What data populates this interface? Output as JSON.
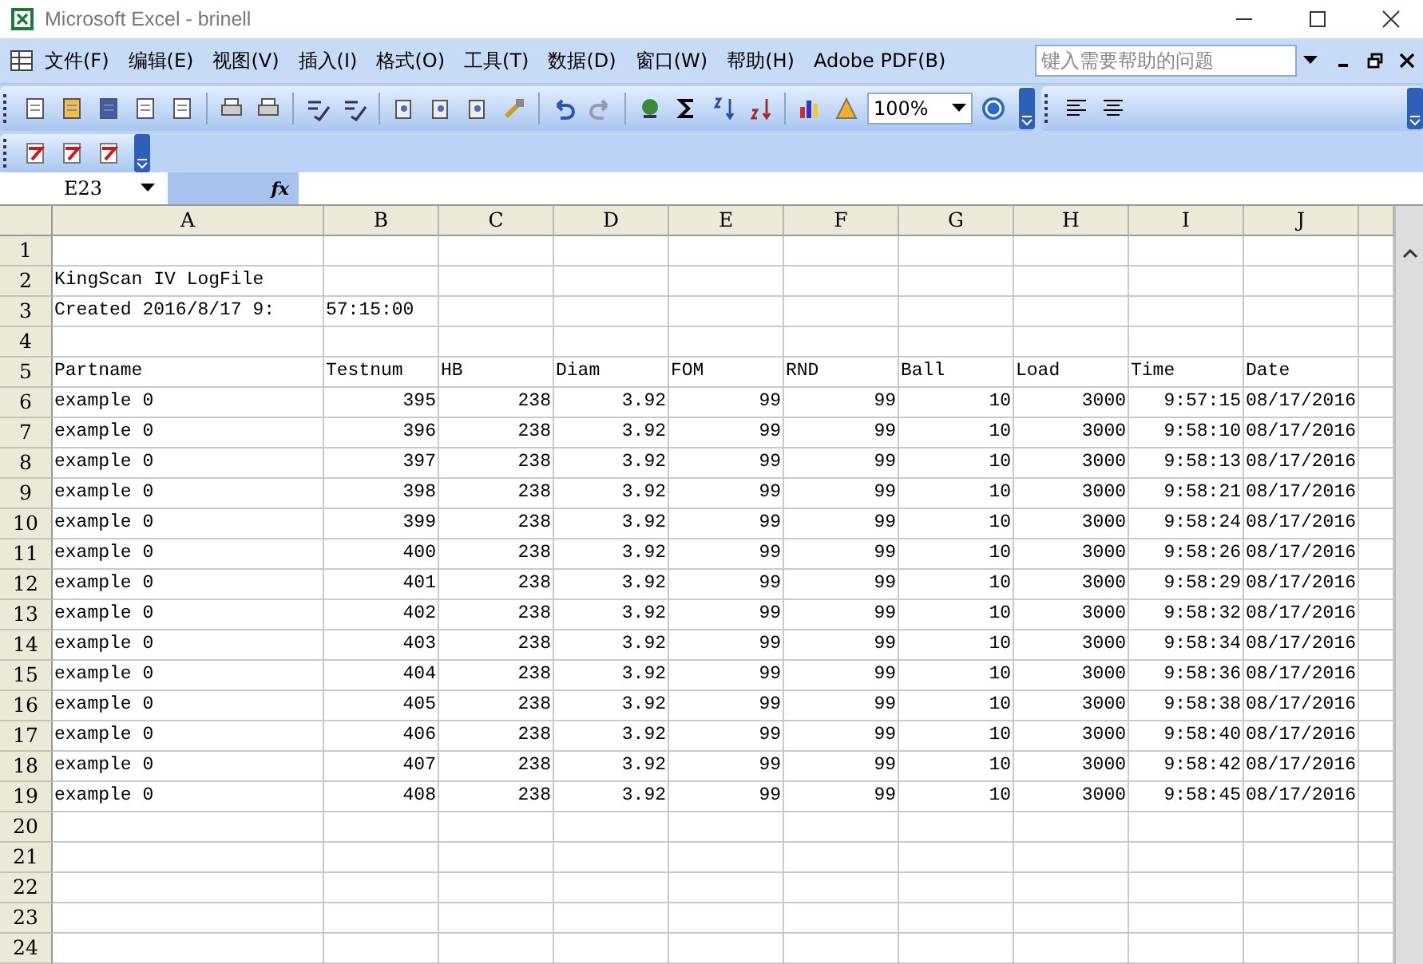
{
  "window": {
    "title": "Microsoft Excel - brinell"
  },
  "menu": [
    "文件(F)",
    "编辑(E)",
    "视图(V)",
    "插入(I)",
    "格式(O)",
    "工具(T)",
    "数据(D)",
    "窗口(W)",
    "帮助(H)",
    "Adobe PDF(B)"
  ],
  "help_box": {
    "placeholder": "键入需要帮助的问题"
  },
  "zoom": {
    "value": "100%"
  },
  "formula_bar": {
    "name_box": "E23",
    "fx_label": "fx"
  },
  "sheet": {
    "columns": [
      "A",
      "B",
      "C",
      "D",
      "E",
      "F",
      "G",
      "H",
      "I",
      "J"
    ],
    "rows": [
      {
        "number": "1",
        "kind": "label"
      },
      {
        "number": "2",
        "kind": "label",
        "cells": [
          "KingScan IV LogFile"
        ]
      },
      {
        "number": "3",
        "kind": "label",
        "cells": [
          "Created 2016/8/17 9:",
          "57:15:00"
        ]
      },
      {
        "number": "4",
        "kind": "label"
      },
      {
        "number": "5",
        "kind": "label",
        "cells": [
          "Partname",
          "Testnum",
          "HB",
          "Diam",
          "FOM",
          "RND",
          "Ball",
          "Load",
          "Time",
          "Date"
        ]
      },
      {
        "number": "6",
        "kind": "data",
        "cells": [
          "example 0",
          "395",
          "238",
          "3.92",
          "99",
          "99",
          "10",
          "3000",
          "9:57:15",
          "08/17/2016"
        ]
      },
      {
        "number": "7",
        "kind": "data",
        "cells": [
          "example 0",
          "396",
          "238",
          "3.92",
          "99",
          "99",
          "10",
          "3000",
          "9:58:10",
          "08/17/2016"
        ]
      },
      {
        "number": "8",
        "kind": "data",
        "cells": [
          "example 0",
          "397",
          "238",
          "3.92",
          "99",
          "99",
          "10",
          "3000",
          "9:58:13",
          "08/17/2016"
        ]
      },
      {
        "number": "9",
        "kind": "data",
        "cells": [
          "example 0",
          "398",
          "238",
          "3.92",
          "99",
          "99",
          "10",
          "3000",
          "9:58:21",
          "08/17/2016"
        ]
      },
      {
        "number": "10",
        "kind": "data",
        "cells": [
          "example 0",
          "399",
          "238",
          "3.92",
          "99",
          "99",
          "10",
          "3000",
          "9:58:24",
          "08/17/2016"
        ]
      },
      {
        "number": "11",
        "kind": "data",
        "cells": [
          "example 0",
          "400",
          "238",
          "3.92",
          "99",
          "99",
          "10",
          "3000",
          "9:58:26",
          "08/17/2016"
        ]
      },
      {
        "number": "12",
        "kind": "data",
        "cells": [
          "example 0",
          "401",
          "238",
          "3.92",
          "99",
          "99",
          "10",
          "3000",
          "9:58:29",
          "08/17/2016"
        ]
      },
      {
        "number": "13",
        "kind": "data",
        "cells": [
          "example 0",
          "402",
          "238",
          "3.92",
          "99",
          "99",
          "10",
          "3000",
          "9:58:32",
          "08/17/2016"
        ]
      },
      {
        "number": "14",
        "kind": "data",
        "cells": [
          "example 0",
          "403",
          "238",
          "3.92",
          "99",
          "99",
          "10",
          "3000",
          "9:58:34",
          "08/17/2016"
        ]
      },
      {
        "number": "15",
        "kind": "data",
        "cells": [
          "example 0",
          "404",
          "238",
          "3.92",
          "99",
          "99",
          "10",
          "3000",
          "9:58:36",
          "08/17/2016"
        ]
      },
      {
        "number": "16",
        "kind": "data",
        "cells": [
          "example 0",
          "405",
          "238",
          "3.92",
          "99",
          "99",
          "10",
          "3000",
          "9:58:38",
          "08/17/2016"
        ]
      },
      {
        "number": "17",
        "kind": "data",
        "cells": [
          "example 0",
          "406",
          "238",
          "3.92",
          "99",
          "99",
          "10",
          "3000",
          "9:58:40",
          "08/17/2016"
        ]
      },
      {
        "number": "18",
        "kind": "data",
        "cells": [
          "example 0",
          "407",
          "238",
          "3.92",
          "99",
          "99",
          "10",
          "3000",
          "9:58:42",
          "08/17/2016"
        ]
      },
      {
        "number": "19",
        "kind": "data",
        "cells": [
          "example 0",
          "408",
          "238",
          "3.92",
          "99",
          "99",
          "10",
          "3000",
          "9:58:45",
          "08/17/2016"
        ]
      },
      {
        "number": "20",
        "kind": "label"
      },
      {
        "number": "21",
        "kind": "label"
      },
      {
        "number": "22",
        "kind": "label"
      },
      {
        "number": "23",
        "kind": "label"
      },
      {
        "number": "24",
        "kind": "label"
      }
    ]
  }
}
